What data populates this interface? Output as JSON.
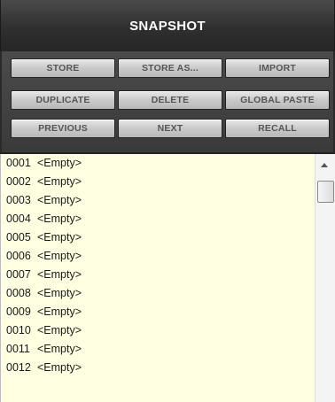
{
  "header": {
    "title": "SNAPSHOT"
  },
  "buttons": {
    "store": "STORE",
    "store_as": "STORE AS...",
    "import": "IMPORT",
    "duplicate": "DUPLICATE",
    "delete": "DELETE",
    "global_paste": "GLOBAL PASTE",
    "previous": "PREVIOUS",
    "next": "NEXT",
    "recall": "RECALL"
  },
  "list": {
    "items": [
      {
        "num": "0001",
        "label": "<Empty>"
      },
      {
        "num": "0002",
        "label": "<Empty>"
      },
      {
        "num": "0003",
        "label": "<Empty>"
      },
      {
        "num": "0004",
        "label": "<Empty>"
      },
      {
        "num": "0005",
        "label": "<Empty>"
      },
      {
        "num": "0006",
        "label": "<Empty>"
      },
      {
        "num": "0007",
        "label": "<Empty>"
      },
      {
        "num": "0008",
        "label": "<Empty>"
      },
      {
        "num": "0009",
        "label": "<Empty>"
      },
      {
        "num": "0010",
        "label": "<Empty>"
      },
      {
        "num": "0011",
        "label": "<Empty>"
      },
      {
        "num": "0012",
        "label": "<Empty>"
      }
    ]
  },
  "colors": {
    "header_bg": "#333333",
    "list_bg": "#ffffe1",
    "button_bg": "#c9c9c9"
  }
}
